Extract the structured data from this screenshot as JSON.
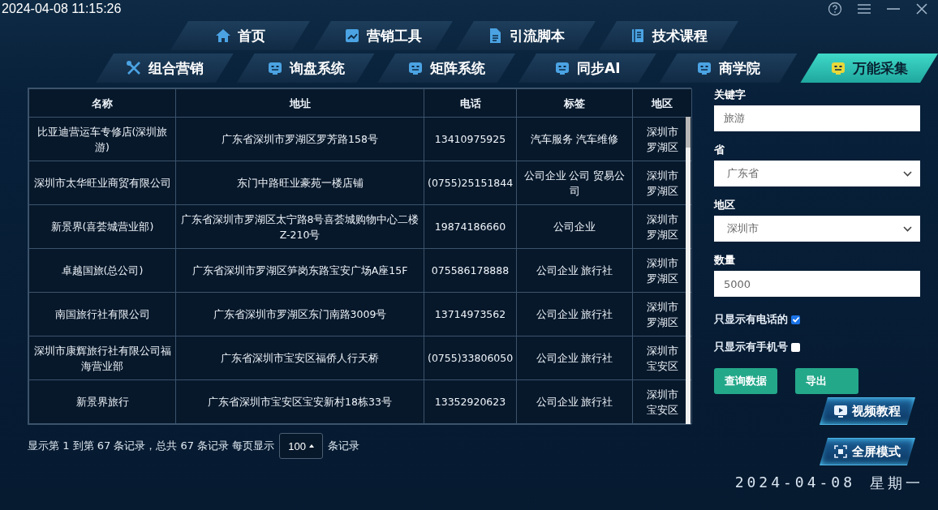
{
  "datetime": "2024-04-08 11:15:26",
  "nav_primary": [
    {
      "label": "首页",
      "kind": "home",
      "selected": false
    },
    {
      "label": "营销工具",
      "kind": "chart",
      "selected": false
    },
    {
      "label": "引流脚本",
      "kind": "doc",
      "selected": false
    },
    {
      "label": "技术课程",
      "kind": "book",
      "selected": false
    }
  ],
  "nav_secondary": [
    {
      "label": "组合营销",
      "kind": "tools",
      "selected": false
    },
    {
      "label": "询盘系统",
      "kind": "bot",
      "selected": false
    },
    {
      "label": "矩阵系统",
      "kind": "bot",
      "selected": false
    },
    {
      "label": "同步AI",
      "kind": "bot",
      "selected": false
    },
    {
      "label": "商学院",
      "kind": "bot",
      "selected": false
    },
    {
      "label": "万能采集",
      "kind": "bot",
      "selected": true
    }
  ],
  "table": {
    "columns": [
      "名称",
      "地址",
      "电话",
      "标签",
      "地区"
    ],
    "rows": [
      [
        "比亚迪营运车专修店(深圳旅游)",
        "广东省深圳市罗湖区罗芳路158号",
        "13410975925",
        "汽车服务 汽车维修",
        "深圳市罗湖区"
      ],
      [
        "深圳市太华旺业商贸有限公司",
        "东门中路旺业豪苑一楼店铺",
        "(0755)25151844",
        "公司企业 公司 贸易公司",
        "深圳市罗湖区"
      ],
      [
        "新景界(喜荟城营业部)",
        "广东省深圳市罗湖区太宁路8号喜荟城购物中心二楼Z-210号",
        "19874186660",
        "公司企业",
        "深圳市罗湖区"
      ],
      [
        "卓越国旅(总公司)",
        "广东省深圳市罗湖区笋岗东路宝安广场A座15F",
        "075586178888",
        "公司企业 旅行社",
        "深圳市罗湖区"
      ],
      [
        "南国旅行社有限公司",
        "广东省深圳市罗湖区东门南路3009号",
        "13714973562",
        "公司企业 旅行社",
        "深圳市罗湖区"
      ],
      [
        "深圳市康辉旅行社有限公司福海营业部",
        "广东省深圳市宝安区福侨人行天桥",
        "(0755)33806050",
        "公司企业 旅行社",
        "深圳市宝安区"
      ],
      [
        "新景界旅行",
        "广东省深圳市宝安区宝安新村18栋33号",
        "13352920623",
        "公司企业 旅行社",
        "深圳市宝安区"
      ]
    ]
  },
  "pagination": {
    "summary": "显示第 1 到第 67 条记录，总共 67 条记录 每页显示",
    "page_size": "100",
    "suffix": "条记录"
  },
  "form": {
    "fields": [
      {
        "kind": "text",
        "label": "关键字",
        "value": "旅游"
      },
      {
        "kind": "select",
        "label": "省",
        "value": "广东省"
      },
      {
        "kind": "select",
        "label": "地区",
        "value": "深圳市"
      },
      {
        "kind": "text",
        "label": "数量",
        "value": "5000"
      }
    ],
    "checkboxes": [
      {
        "label": "只显示有电话的",
        "checked": true
      },
      {
        "label": "只显示有手机号",
        "checked": false
      }
    ],
    "buttons": [
      "查询数据",
      "导出"
    ]
  },
  "floating_buttons": [
    {
      "label": "视频教程",
      "kind": "play"
    },
    {
      "label": "全屏模式",
      "kind": "fullscreen"
    }
  ],
  "date": "2024-04-08",
  "weekday": "星期一"
}
